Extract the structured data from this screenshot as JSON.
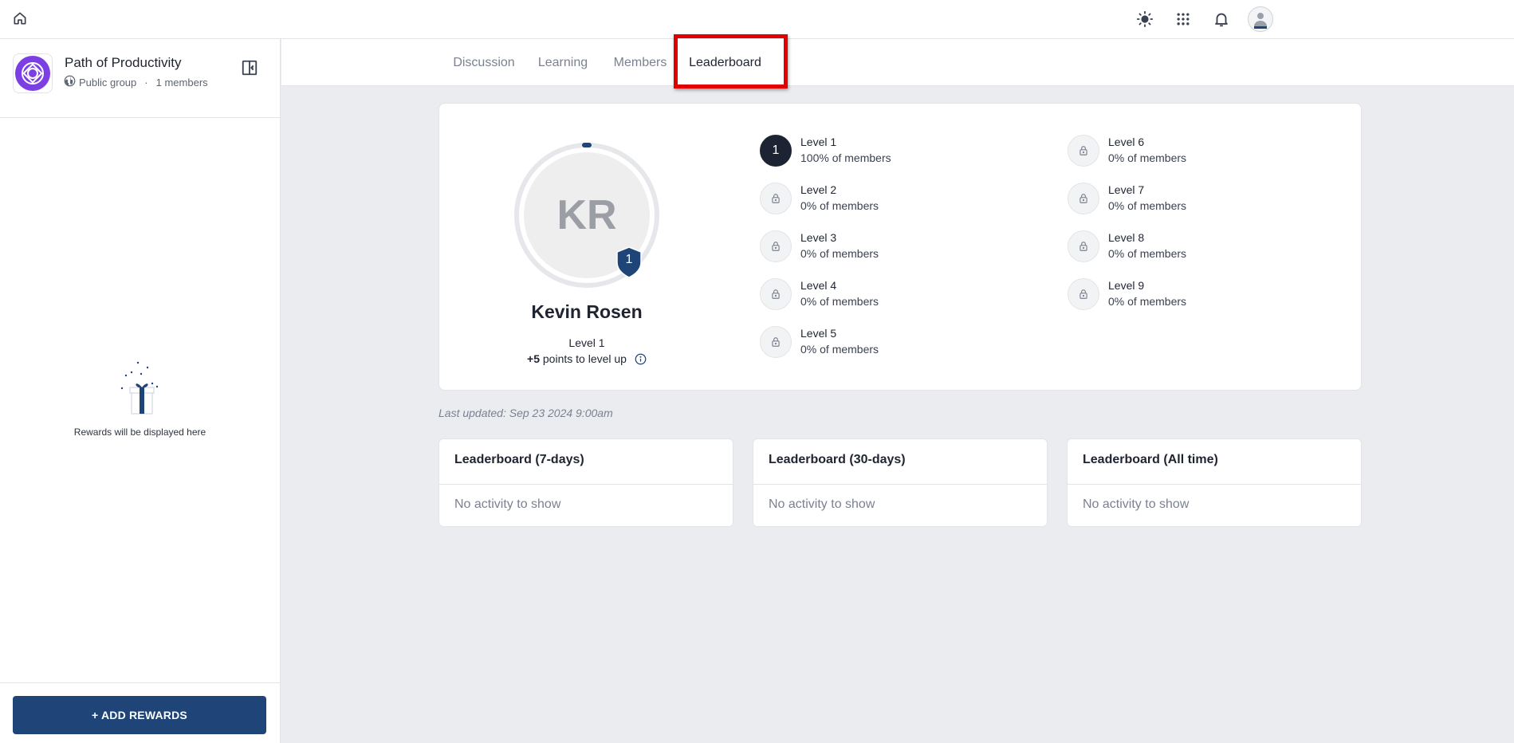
{
  "topbar": {
    "home_icon": "home-icon",
    "theme_icon": "sun-icon",
    "apps_icon": "grid-icon",
    "notifications_icon": "bell-icon",
    "avatar_icon": "user-avatar"
  },
  "group": {
    "name": "Path of Productivity",
    "visibility": "Public group",
    "separator": "·",
    "members": "1 members"
  },
  "rewards": {
    "empty_text": "Rewards will be displayed here",
    "add_button": "+ ADD REWARDS"
  },
  "tabs": [
    {
      "label": "Discussion",
      "active": false
    },
    {
      "label": "Learning",
      "active": false
    },
    {
      "label": "Members",
      "active": false
    },
    {
      "label": "Leaderboard",
      "active": true
    }
  ],
  "profile": {
    "initials": "KR",
    "badge_level": "1",
    "name": "Kevin Rosen",
    "level": "Level 1",
    "points": "+5",
    "points_suffix": "points to level up"
  },
  "levels": [
    {
      "number": "1",
      "name": "Level 1",
      "pct": "100% of members",
      "unlocked": true
    },
    {
      "number": "2",
      "name": "Level 2",
      "pct": "0% of members",
      "unlocked": false
    },
    {
      "number": "3",
      "name": "Level 3",
      "pct": "0% of members",
      "unlocked": false
    },
    {
      "number": "4",
      "name": "Level 4",
      "pct": "0% of members",
      "unlocked": false
    },
    {
      "number": "5",
      "name": "Level 5",
      "pct": "0% of members",
      "unlocked": false
    },
    {
      "number": "6",
      "name": "Level 6",
      "pct": "0% of members",
      "unlocked": false
    },
    {
      "number": "7",
      "name": "Level 7",
      "pct": "0% of members",
      "unlocked": false
    },
    {
      "number": "8",
      "name": "Level 8",
      "pct": "0% of members",
      "unlocked": false
    },
    {
      "number": "9",
      "name": "Level 9",
      "pct": "0% of members",
      "unlocked": false
    }
  ],
  "last_updated": "Last updated: Sep 23 2024 9:00am",
  "leaderboards": [
    {
      "title": "Leaderboard (7-days)",
      "empty": "No activity to show"
    },
    {
      "title": "Leaderboard (30-days)",
      "empty": "No activity to show"
    },
    {
      "title": "Leaderboard (All time)",
      "empty": "No activity to show"
    }
  ],
  "colors": {
    "primary": "#1e4478",
    "badge": "#1e4478",
    "active_level": "#1c2433",
    "group_logo": "#7b3fe4",
    "highlight": "#e00000"
  }
}
